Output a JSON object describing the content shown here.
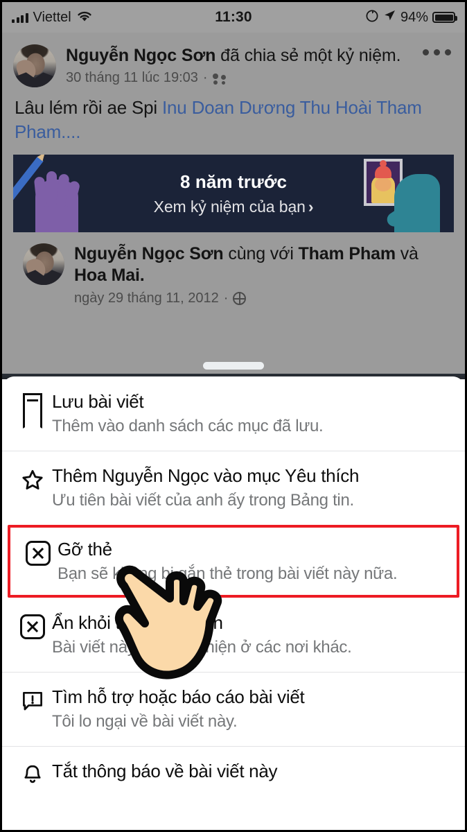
{
  "status_bar": {
    "carrier": "Viettel",
    "time": "11:30",
    "battery_percent": "94%",
    "icons": [
      "signal-bars-icon",
      "wifi-icon",
      "rotation-lock-icon",
      "location-arrow-icon",
      "battery-icon"
    ]
  },
  "post": {
    "author": "Nguyễn Ngọc Sơn",
    "action_text": " đã chia sẻ một kỷ niệm.",
    "timestamp": "30 tháng 11 lúc 19:03",
    "separator": "·",
    "audience_icon": "friends-icon",
    "more_icon": "more-options-icon",
    "body_prefix": "Lâu lém rồi ae Spi ",
    "body_tags": "Inu Doan Dương Thu Hoài Tham Pham",
    "body_suffix": "...."
  },
  "memory_card": {
    "title": "8 năm trước",
    "subtitle": "Xem kỷ niệm của bạn",
    "chevron": "›",
    "bg_color": "#1b2338",
    "left_illustration": "hand-holding-pencil-illustration",
    "right_illustration": "hand-holding-framed-photo-illustration"
  },
  "shared_post": {
    "author": "Nguyễn Ngọc Sơn",
    "with_text": " cùng với ",
    "person_1": "Tham Pham",
    "and_text": " và ",
    "person_2": "Hoa Mai.",
    "date": "ngày 29 tháng 11, 2012",
    "separator": "·",
    "privacy_icon": "globe-icon"
  },
  "action_sheet": {
    "grabber": "sheet-grabber",
    "highlight_color": "#ed1c24",
    "items": [
      {
        "icon": "bookmark-icon",
        "title": "Lưu bài viết",
        "subtitle": "Thêm vào danh sách các mục đã lưu."
      },
      {
        "icon": "star-icon",
        "title": "Thêm Nguyễn Ngọc vào mục Yêu thích",
        "subtitle": "Ưu tiên bài viết của anh ấy trong Bảng tin."
      },
      {
        "icon": "x-box-icon",
        "title": "Gỡ thẻ",
        "subtitle": "Bạn sẽ không bị gắn thẻ trong bài viết này nữa.",
        "highlighted": true
      },
      {
        "icon": "x-box-icon",
        "title": "Ẩn khỏi trang cá nhân",
        "subtitle": "Bài viết này vẫn xuất hiện ở các nơi khác."
      },
      {
        "icon": "report-icon",
        "title": "Tìm hỗ trợ hoặc báo cáo bài viết",
        "subtitle": "Tôi lo ngại về bài viết này."
      },
      {
        "icon": "bell-icon",
        "title": "Tắt thông báo về bài viết này",
        "subtitle": ""
      }
    ]
  },
  "cursor": {
    "type": "pointing-hand-cursor",
    "skin_color": "#fbd9a9"
  }
}
